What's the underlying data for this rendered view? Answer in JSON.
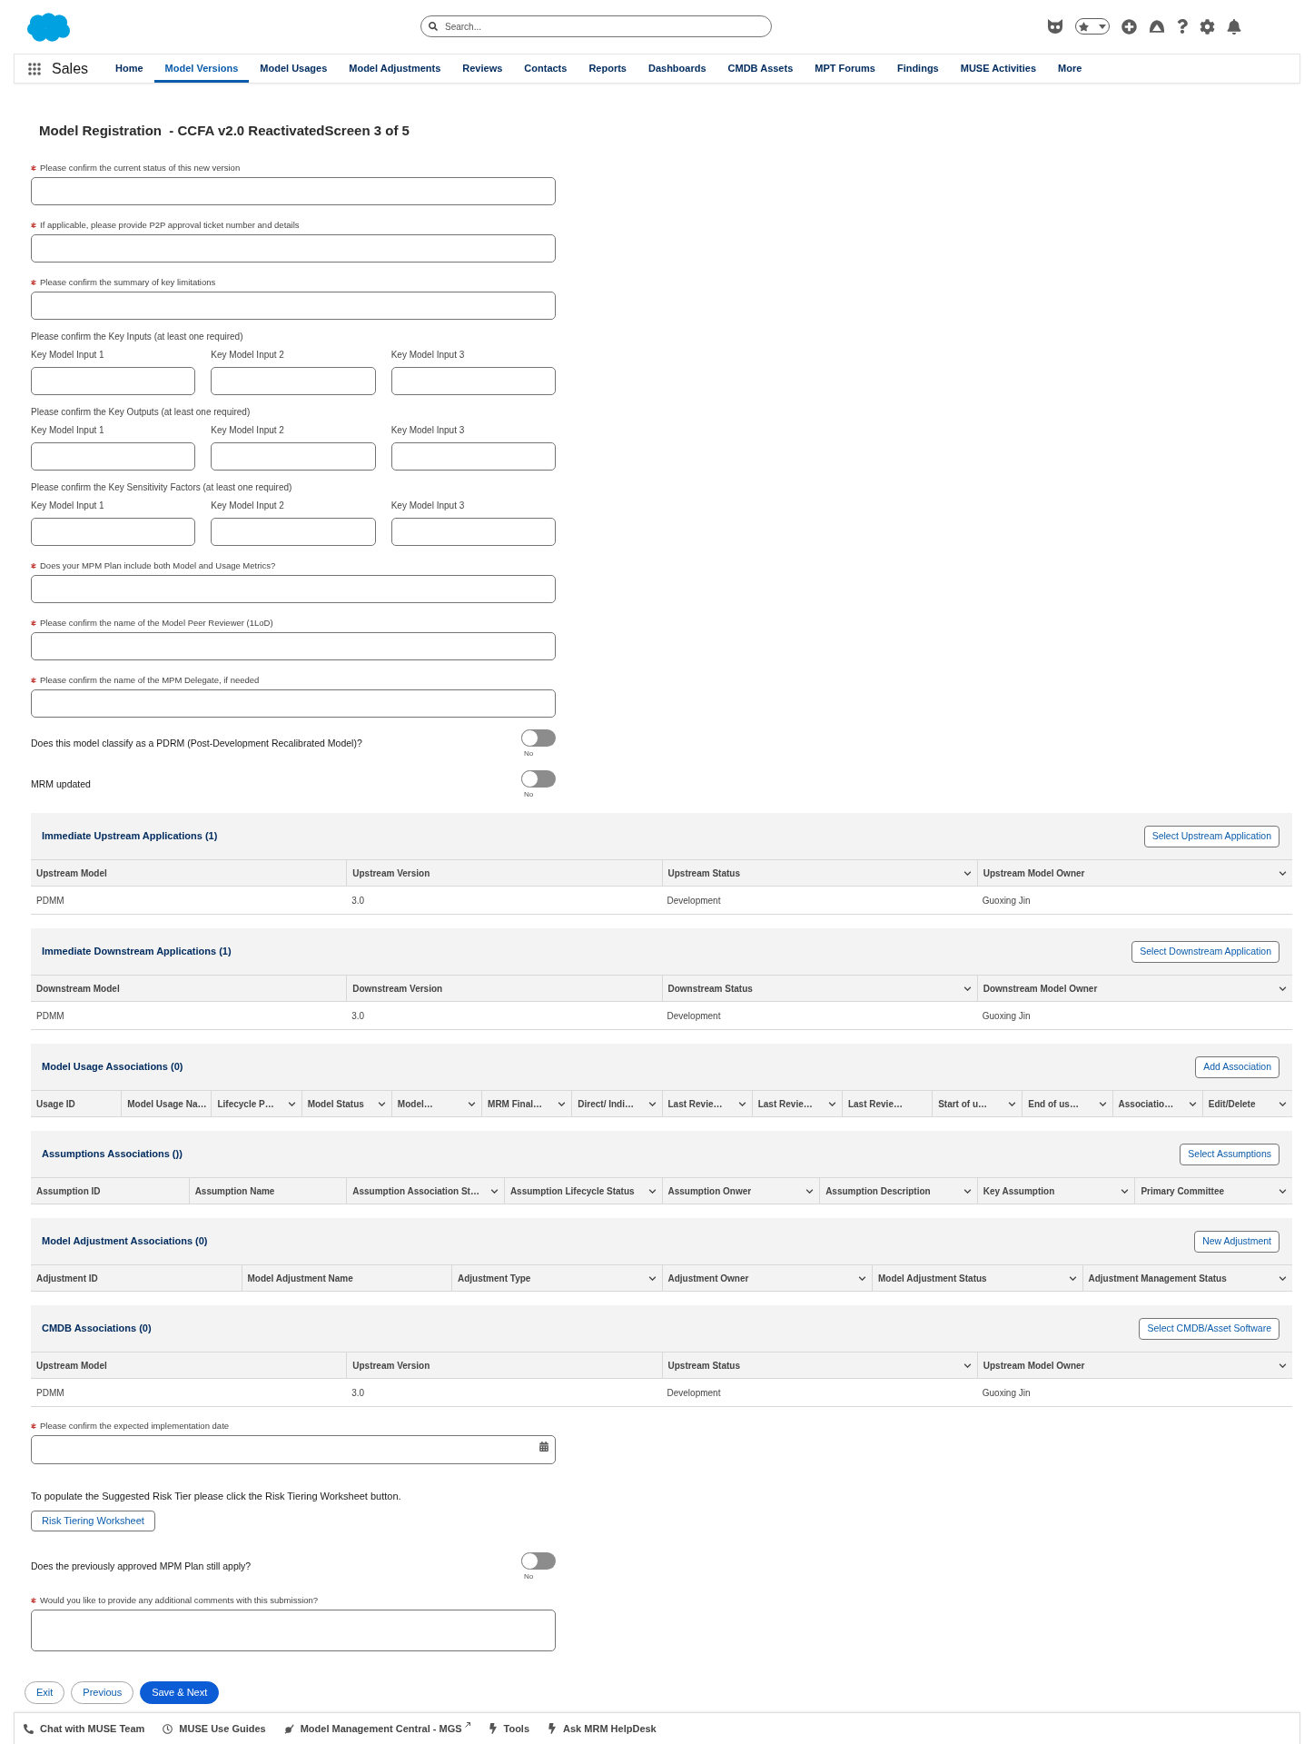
{
  "header": {
    "search": {
      "placeholder": "Search..."
    }
  },
  "nav": {
    "app_name": "Sales",
    "items": [
      {
        "label": "Home",
        "selected": false
      },
      {
        "label": "Model Versions",
        "selected": true
      },
      {
        "label": "Model Usages",
        "selected": false
      },
      {
        "label": "Model Adjustments",
        "selected": false
      },
      {
        "label": "Reviews",
        "selected": false
      },
      {
        "label": "Contacts",
        "selected": false
      },
      {
        "label": "Reports",
        "selected": false
      },
      {
        "label": "Dashboards",
        "selected": false
      },
      {
        "label": "CMDB Assets",
        "selected": false
      },
      {
        "label": "MPT Forums",
        "selected": false
      },
      {
        "label": "Findings",
        "selected": false
      },
      {
        "label": "MUSE Activities",
        "selected": false
      },
      {
        "label": "More",
        "selected": false
      }
    ]
  },
  "page_title": "Model Registration  - CCFA v2.0 ReactivatedScreen 3 of 5",
  "content": [
    {
      "kind": "text_field",
      "label": "Please confirm the current status of this new version",
      "required": true
    },
    {
      "kind": "text_field",
      "label": "If applicable, please provide P2P approval ticket number and details",
      "required": true
    },
    {
      "kind": "text_field",
      "label": "Please confirm the summary of key limitations",
      "required": true
    },
    {
      "kind": "input_group",
      "label": "Please confirm the Key Inputs (at least one required)",
      "inputs": [
        "Key Model Input 1",
        "Key Model Input 2",
        "Key Model Input 3"
      ]
    },
    {
      "kind": "input_group",
      "label": "Please confirm the Key Outputs (at least one required)",
      "inputs": [
        "Key Model Input 1",
        "Key Model Input 2",
        "Key Model Input 3"
      ]
    },
    {
      "kind": "input_group",
      "label": "Please confirm the Key Sensitivity Factors (at least one required)",
      "inputs": [
        "Key Model Input 1",
        "Key Model Input 2",
        "Key Model Input 3"
      ]
    },
    {
      "kind": "text_field",
      "label": "Does your MPM Plan include both Model and Usage Metrics?",
      "required": true
    },
    {
      "kind": "text_field",
      "label": "Please confirm the name of the Model Peer Reviewer (1LoD)",
      "required": true
    },
    {
      "kind": "text_field",
      "label": "Please confirm the name of the MPM Delegate, if needed",
      "required": true
    },
    {
      "kind": "toggle",
      "label": "Does this model classify as a PDRM (Post-Development Recalibrated Model)?",
      "on": false,
      "state_text": "No"
    },
    {
      "kind": "toggle",
      "label": "MRM updated",
      "on": false,
      "state_text": "No"
    },
    {
      "kind": "related_list",
      "title": "Immediate Upstream Applications (1)",
      "button": "Select Upstream Application",
      "columns": [
        {
          "label": "Upstream Model",
          "menu": false
        },
        {
          "label": "Upstream Version",
          "menu": false
        },
        {
          "label": "Upstream Status",
          "menu": true
        },
        {
          "label": "Upstream Model Owner",
          "menu": true
        }
      ],
      "rows": [
        [
          "PDMM",
          "3.0",
          "Development",
          "Guoxing Jin"
        ]
      ]
    },
    {
      "kind": "related_list",
      "title": "Immediate Downstream Applications (1)",
      "button": "Select Downstream Application",
      "columns": [
        {
          "label": "Downstream Model",
          "menu": false
        },
        {
          "label": "Downstream Version",
          "menu": false
        },
        {
          "label": "Downstream Status",
          "menu": true
        },
        {
          "label": "Downstream Model Owner",
          "menu": true
        }
      ],
      "rows": [
        [
          "PDMM",
          "3.0",
          "Development",
          "Guoxing Jin"
        ]
      ]
    },
    {
      "kind": "related_list",
      "title": "Model Usage Associations (0)",
      "button": "Add Association",
      "columns": [
        {
          "label": "Usage ID",
          "menu": false
        },
        {
          "label": "Model Usage Na…",
          "menu": false
        },
        {
          "label": "Lifecycle P…",
          "menu": true
        },
        {
          "label": "Model Status",
          "menu": true
        },
        {
          "label": "Model…",
          "menu": true
        },
        {
          "label": "MRM Final…",
          "menu": true
        },
        {
          "label": "Direct/ Indi…",
          "menu": true
        },
        {
          "label": "Last Revie…",
          "menu": true
        },
        {
          "label": "Last Revie…",
          "menu": true
        },
        {
          "label": "Last Revie…",
          "menu": false
        },
        {
          "label": "Start of u…",
          "menu": true
        },
        {
          "label": "End of us…",
          "menu": true
        },
        {
          "label": "Associatio…",
          "menu": true
        },
        {
          "label": "Edit/Delete",
          "menu": true
        }
      ]
    },
    {
      "kind": "related_list",
      "title": "Assumptions Associations ())",
      "button": "Select Assumptions",
      "columns": [
        {
          "label": "Assumption ID",
          "menu": false
        },
        {
          "label": "Assumption Name",
          "menu": false
        },
        {
          "label": "Assumption Association St…",
          "menu": true
        },
        {
          "label": "Assumption Lifecycle Status",
          "menu": true
        },
        {
          "label": "Assumption Onwer",
          "menu": true
        },
        {
          "label": "Assumption Description",
          "menu": true
        },
        {
          "label": "Key Assumption",
          "menu": true
        },
        {
          "label": "Primary Committee",
          "menu": true
        }
      ]
    },
    {
      "kind": "related_list",
      "title": "Model Adjustment Associations (0)",
      "button": "New Adjustment",
      "columns": [
        {
          "label": "Adjustment ID",
          "menu": false
        },
        {
          "label": "Model Adjustment Name",
          "menu": false
        },
        {
          "label": "Adjustment Type",
          "menu": true
        },
        {
          "label": "Adjustment Owner",
          "menu": true
        },
        {
          "label": "Model Adjustment Status",
          "menu": true
        },
        {
          "label": "Adjustment Management Status",
          "menu": true
        }
      ]
    },
    {
      "kind": "related_list",
      "title": "CMDB Associations (0)",
      "button": "Select CMDB/Asset Software",
      "columns": [
        {
          "label": "Upstream Model",
          "menu": false
        },
        {
          "label": "Upstream Version",
          "menu": false
        },
        {
          "label": "Upstream Status",
          "menu": true
        },
        {
          "label": "Upstream Model Owner",
          "menu": true
        }
      ],
      "rows": [
        [
          "PDMM",
          "3.0",
          "Development",
          "Guoxing Jin"
        ]
      ]
    },
    {
      "kind": "date_field",
      "label": "Please confirm the expected implementation date",
      "required": true
    },
    {
      "kind": "note",
      "text": "To populate the Suggested Risk Tier please click the Risk Tiering Worksheet button.",
      "button": "Risk Tiering Worksheet"
    },
    {
      "kind": "toggle",
      "label": "Does the previously approved MPM Plan still apply?",
      "on": false,
      "state_text": "No"
    },
    {
      "kind": "textarea",
      "label": "Would you like to provide any additional comments with this submission?",
      "required": true
    }
  ],
  "actions": [
    {
      "label": "Exit",
      "kind": "neutral"
    },
    {
      "label": "Previous",
      "kind": "neutral"
    },
    {
      "label": "Save & Next",
      "kind": "brand"
    }
  ],
  "utility_bar": {
    "items": [
      {
        "label": "Chat with MUSE Team",
        "external": false
      },
      {
        "label": "MUSE Use Guides",
        "external": false
      },
      {
        "label": "Model Management Central - MGS",
        "external": true
      },
      {
        "label": "Tools",
        "external": false
      },
      {
        "label": "Ask MRM HelpDesk",
        "external": false
      }
    ]
  }
}
